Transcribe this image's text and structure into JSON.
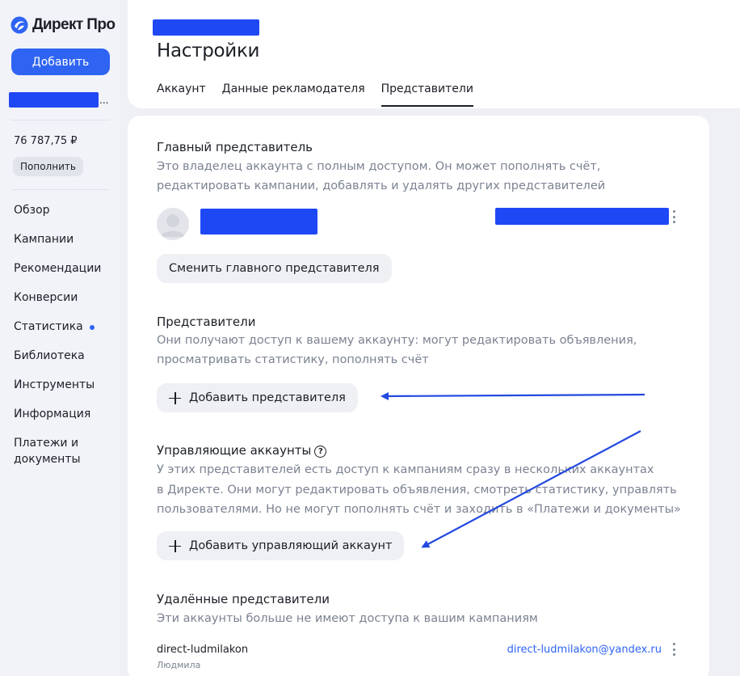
{
  "app": {
    "name": "Директ Про",
    "add_label": "Добавить"
  },
  "account": {
    "balance": "76 787,75 ₽",
    "topup_label": "Пополнить",
    "login_suffix": "..."
  },
  "nav": [
    {
      "label": "Обзор"
    },
    {
      "label": "Кампании"
    },
    {
      "label": "Рекомендации"
    },
    {
      "label": "Конверсии"
    },
    {
      "label": "Статистика",
      "has_dot": true
    },
    {
      "label": "Библиотека"
    },
    {
      "label": "Инструменты"
    },
    {
      "label": "Информация"
    },
    {
      "label": "Платежи и документы"
    }
  ],
  "header": {
    "title": "Настройки",
    "tabs": [
      {
        "label": "Аккаунт",
        "active": false
      },
      {
        "label": "Данные рекламодателя",
        "active": false
      },
      {
        "label": "Представители",
        "active": true
      }
    ]
  },
  "main_rep": {
    "title": "Главный представитель",
    "desc_line1": "Это владелец аккаунта с полным доступом. Он может пополнять счёт,",
    "desc_line2": "редактировать кампании, добавлять и удалять других представителей",
    "change_label": "Сменить главного представителя"
  },
  "reps": {
    "title": "Представители",
    "desc_line1": "Они получают доступ к вашему аккаунту: могут редактировать объявления,",
    "desc_line2": "просматривать статистику, пополнять счёт",
    "add_label": "Добавить представителя"
  },
  "managing": {
    "title": "Управляющие аккаунты",
    "help": "?",
    "desc_line1": "У этих представителей есть доступ к кампаниям сразу в нескольких аккаунтах",
    "desc_line2": "в Директе. Они могут редактировать объявления, смотреть статистику, управлять",
    "desc_line3": "пользователями. Но не могут пополнять счёт и заходить в «Платежи и документы»",
    "add_label": "Добавить управляющий аккаунт"
  },
  "removed": {
    "title": "Удалённые представители",
    "desc": "Эти аккаунты больше не имеют доступа к вашим кампаниям",
    "items": [
      {
        "login": "direct-ludmilakon",
        "name": "Людмила",
        "email": "direct-ludmilakon@yandex.ru"
      }
    ]
  },
  "colors": {
    "accent": "#2f64f3",
    "redaction": "#1f48f5",
    "annotation_arrow": "#2349e0"
  }
}
